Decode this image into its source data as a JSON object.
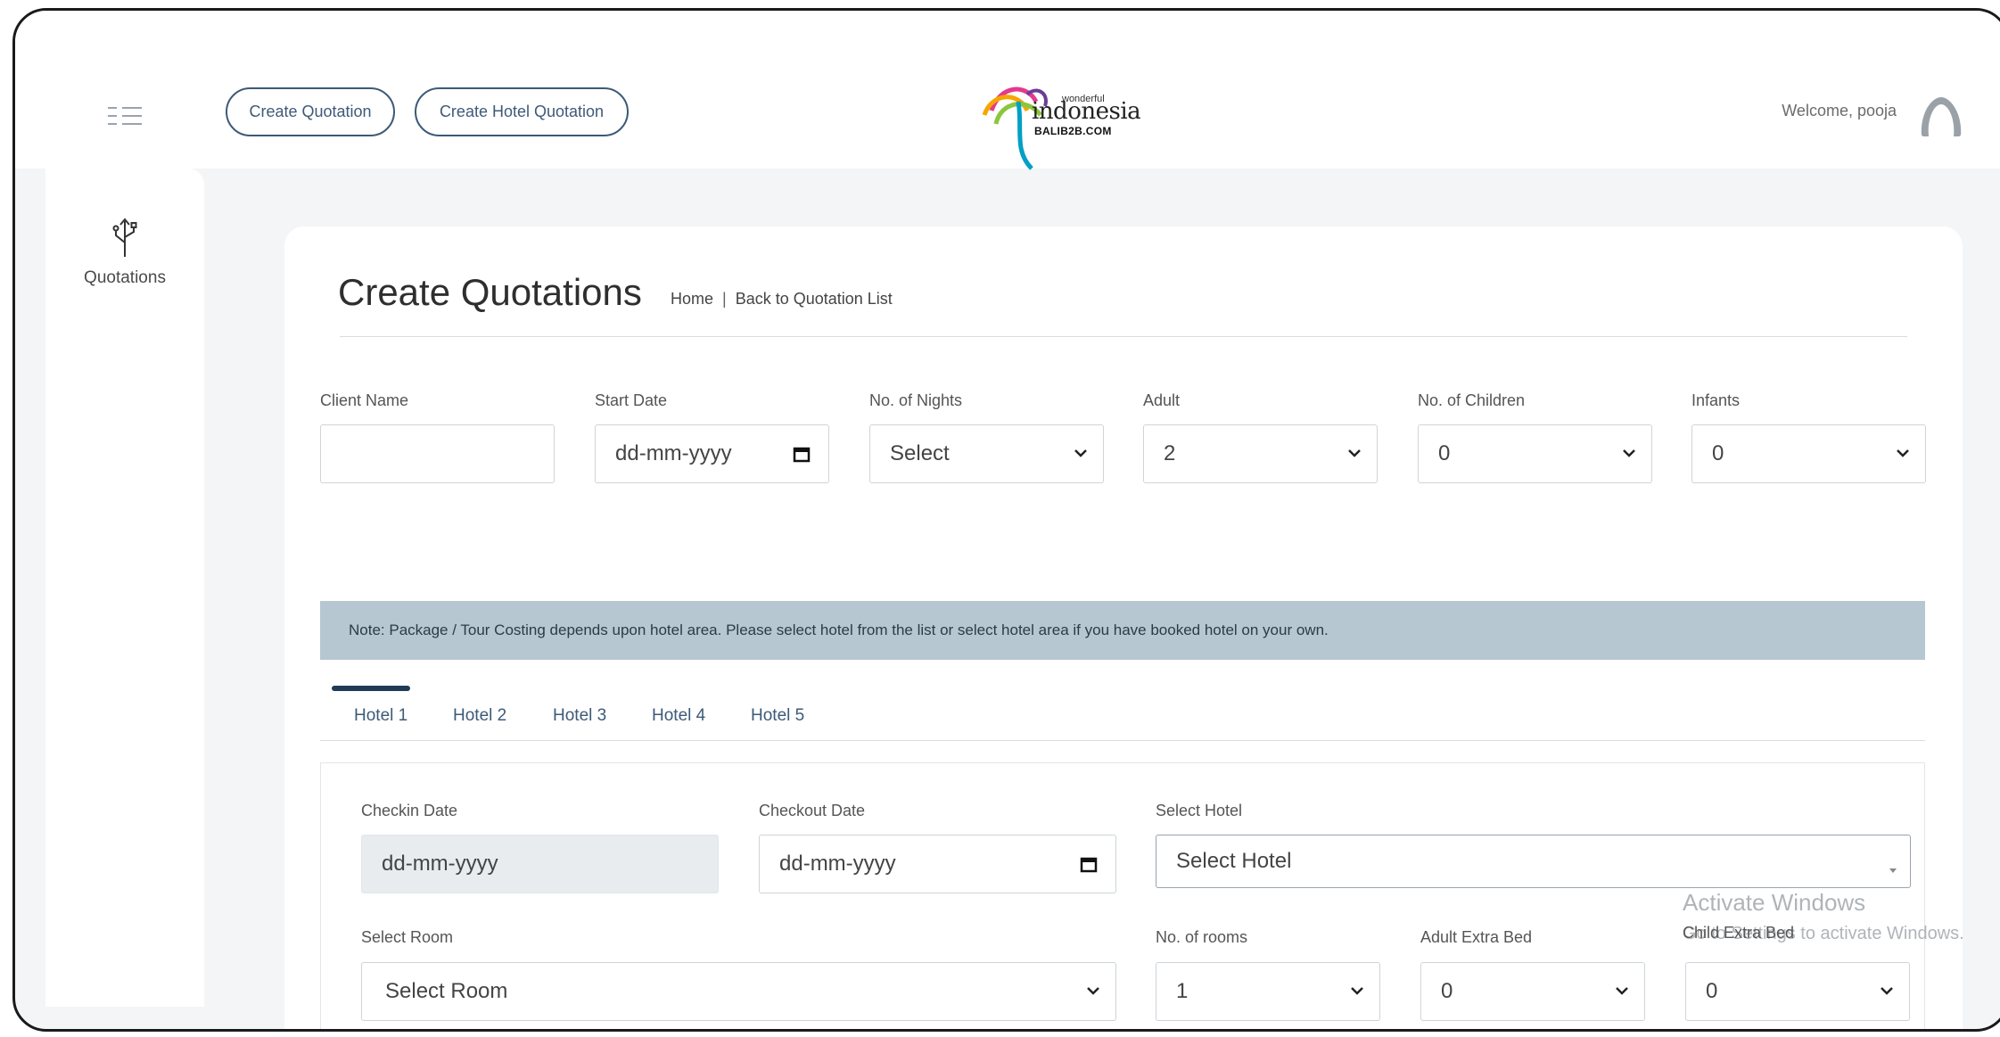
{
  "header": {
    "create_quotation_label": "Create Quotation",
    "create_hotel_quotation_label": "Create Hotel Quotation",
    "logo_small": "wonderful",
    "logo_main": "indonesia",
    "logo_url": "BALIB2B.COM",
    "welcome_text": "Welcome, pooja"
  },
  "sidebar": {
    "items": [
      {
        "label": "Quotations",
        "icon": "usb-icon"
      }
    ]
  },
  "page": {
    "title": "Create Quotations",
    "breadcrumb": {
      "home": "Home",
      "separator": "|",
      "back": "Back to Quotation List"
    }
  },
  "form": {
    "client_name": {
      "label": "Client Name",
      "value": ""
    },
    "start_date": {
      "label": "Start Date",
      "value": "dd-mm-yyyy"
    },
    "nights": {
      "label": "No. of Nights",
      "value": "Select"
    },
    "adult": {
      "label": "Adult",
      "value": "2"
    },
    "children": {
      "label": "No. of Children",
      "value": "0"
    },
    "infants": {
      "label": "Infants",
      "value": "0"
    }
  },
  "note": "Note: Package / Tour Costing depends upon hotel area. Please select hotel from the list or select hotel area if you have booked hotel on your own.",
  "hotel_tabs": [
    "Hotel 1",
    "Hotel 2",
    "Hotel 3",
    "Hotel 4",
    "Hotel 5"
  ],
  "hotel": {
    "checkin": {
      "label": "Checkin Date",
      "value": "dd-mm-yyyy"
    },
    "checkout": {
      "label": "Checkout Date",
      "value": "dd-mm-yyyy"
    },
    "select_hotel": {
      "label": "Select Hotel",
      "value": "Select Hotel"
    },
    "select_room": {
      "label": "Select Room",
      "value": "Select Room"
    },
    "rooms": {
      "label": "No. of rooms",
      "value": "1"
    },
    "adult_extra_bed": {
      "label": "Adult Extra Bed",
      "value": "0"
    },
    "child_extra_bed": {
      "label": "Child Extra Bed",
      "value": "0"
    }
  },
  "watermark": {
    "line1": "Activate Windows",
    "line2": "Go to Settings to activate Windows."
  },
  "colors": {
    "accent": "#3d5a78",
    "note_bg": "#b7c7d1",
    "page_bg": "#f4f5f7",
    "tab_indicator": "#1f3b57"
  }
}
